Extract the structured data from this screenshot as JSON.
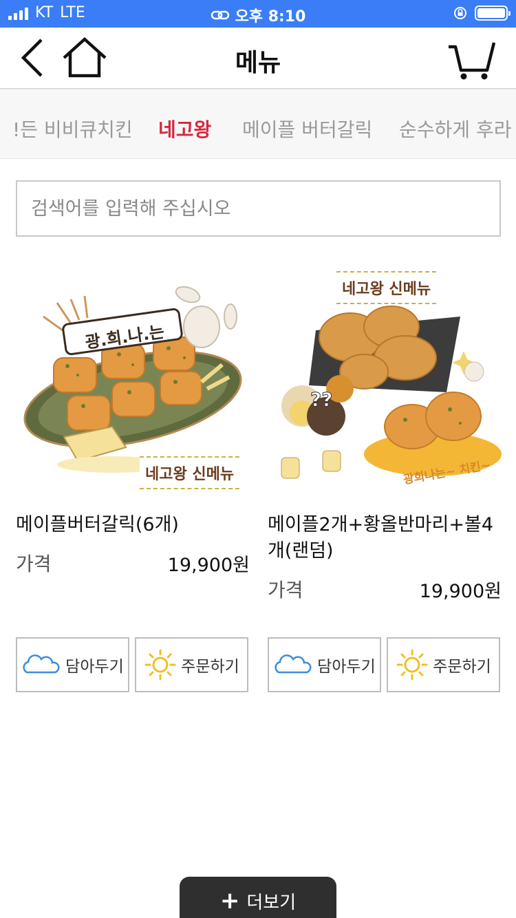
{
  "status_bar": {
    "carrier": "KT",
    "network": "LTE",
    "time": "오후 8:10"
  },
  "header": {
    "title": "메뉴"
  },
  "tabs": [
    {
      "label": "!든 비비큐치킨",
      "active": false
    },
    {
      "label": "네고왕",
      "active": true
    },
    {
      "label": "메이플 버터갈릭",
      "active": false
    },
    {
      "label": "순수하게 후라",
      "active": false
    }
  ],
  "search": {
    "placeholder": "검색어를 입력해 주십시오"
  },
  "products": [
    {
      "name": "메이플버터갈릭(6개)",
      "price_label": "가격",
      "price": "19,900원",
      "image_badge": "네고왕 신메뉴",
      "image_text": "광.희.나.는",
      "cart_label": "담아두기",
      "order_label": "주문하기"
    },
    {
      "name": "메이플2개+황올반마리+볼4개(랜덤)",
      "price_label": "가격",
      "price": "19,900원",
      "image_badge": "네고왕 신메뉴",
      "image_text": "광희나는~ 치킨~",
      "cart_label": "담아두기",
      "order_label": "주문하기"
    }
  ],
  "more_button": {
    "label": "더보기"
  },
  "colors": {
    "status_bar": "#3a7df6",
    "active_tab": "#d6283e",
    "more_button": "#2f2f2f"
  }
}
